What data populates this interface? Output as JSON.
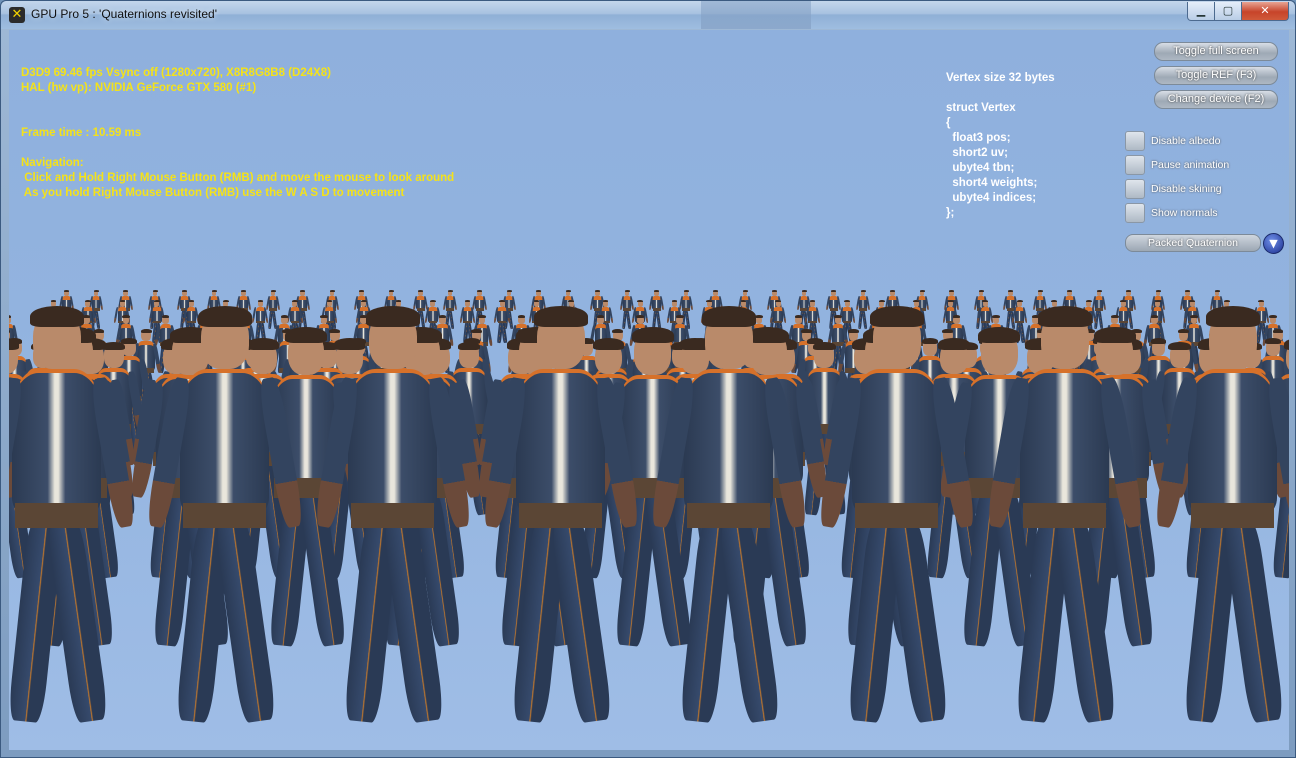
{
  "window": {
    "title": "GPU Pro 5 : 'Quaternions revisited'",
    "app_icon": "x-app-icon",
    "controls": {
      "minimize": "▁",
      "maximize": "▢",
      "close": "✕"
    }
  },
  "hud": {
    "stats_line1": "D3D9 69.46 fps Vsync off (1280x720), X8R8G8B8 (D24X8)",
    "stats_line2": "HAL (hw vp): NVIDIA GeForce GTX 580 (#1)",
    "frame_time": "Frame time : 10.59 ms",
    "nav_title": "Navigation:",
    "nav_line1": " Click and Hold Right Mouse Button (RMB) and move the mouse to look around",
    "nav_line2": " As you hold Right Mouse Button (RMB) use the W A S D to movement"
  },
  "vertex_info": {
    "size": "Vertex size 32 bytes",
    "struct_header": "struct Vertex",
    "open_brace": "{",
    "fields": [
      "float3 pos;",
      "short2 uv;",
      "ubyte4 tbn;",
      "short4 weights;",
      "ubyte4 indices;"
    ],
    "close_brace": "};"
  },
  "gui": {
    "buttons": {
      "toggle_full_screen": "Toggle full screen",
      "toggle_ref": "Toggle REF (F3)",
      "change_device": "Change device (F2)"
    },
    "checkboxes": {
      "disable_albedo": "Disable albedo",
      "pause_animation": "Pause animation",
      "disable_skinning": "Disable skining",
      "show_normals": "Show normals"
    },
    "combo": {
      "selected": "Packed Quaternion",
      "arrow_icon": "▼"
    }
  },
  "colors": {
    "hud_text": "#f4e21a",
    "sky": "#92b3df",
    "floor_blue": "#3a63c0",
    "floor_light": "#b9c6d6"
  }
}
